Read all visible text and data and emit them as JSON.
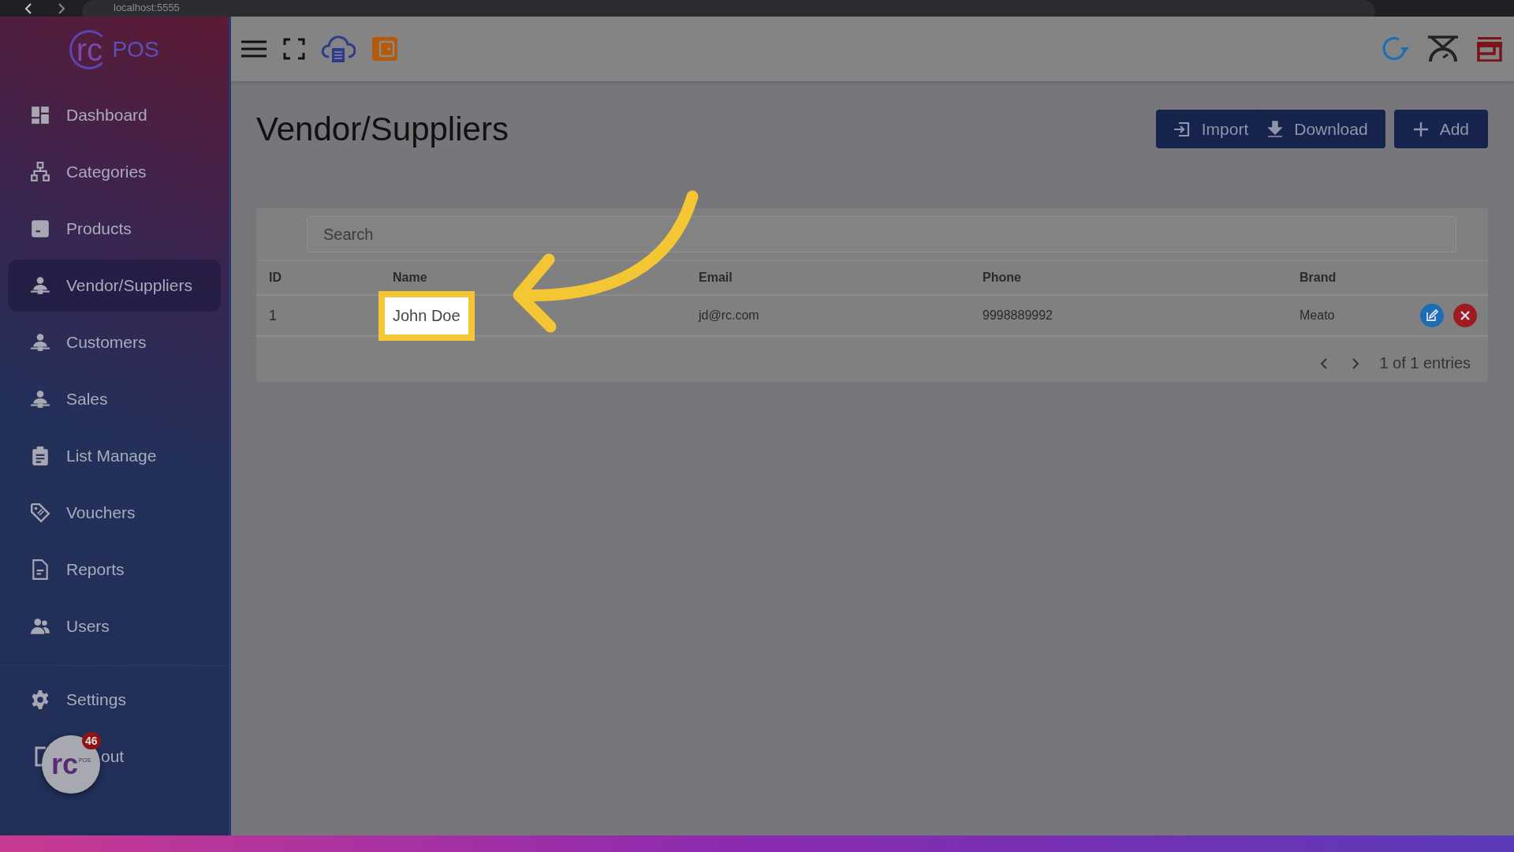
{
  "browser": {
    "url": "localhost:5555"
  },
  "logo": {
    "mark": "rc",
    "text": "POS"
  },
  "sidebar": {
    "items": [
      {
        "label": "Dashboard",
        "selected": false
      },
      {
        "label": "Categories",
        "selected": false
      },
      {
        "label": "Products",
        "selected": false
      },
      {
        "label": "Vendor/Suppliers",
        "selected": true
      },
      {
        "label": "Customers",
        "selected": false
      },
      {
        "label": "Sales",
        "selected": false
      },
      {
        "label": "List Manage",
        "selected": false
      },
      {
        "label": "Vouchers",
        "selected": false
      },
      {
        "label": "Reports",
        "selected": false
      },
      {
        "label": "Users",
        "selected": false
      }
    ],
    "settings": "Settings",
    "logout": "out"
  },
  "chat_bubble": {
    "mark": "rc",
    "sub": "POS",
    "badge": "46"
  },
  "page": {
    "title": "Vendor/Suppliers",
    "buttons": [
      "Import",
      "Download",
      "Add"
    ]
  },
  "search": {
    "placeholder": "Search"
  },
  "table": {
    "columns": [
      "ID",
      "Name",
      "Email",
      "Phone",
      "Brand"
    ],
    "rows": [
      {
        "cells": [
          "1",
          "John Doe",
          "jd@rc.com",
          "9998889992",
          "Meato"
        ],
        "highlighted": true
      }
    ]
  },
  "pagination": {
    "text": "1 of 1 entries"
  }
}
